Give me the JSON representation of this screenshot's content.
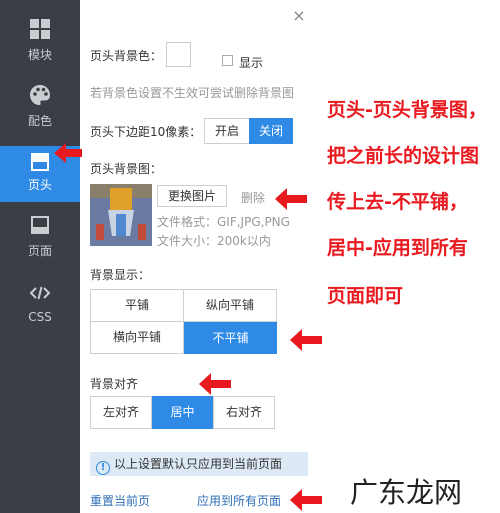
{
  "sidebar": {
    "items": [
      {
        "label": "模块",
        "icon": "grid-icon"
      },
      {
        "label": "配色",
        "icon": "palette-icon"
      },
      {
        "label": "页头",
        "icon": "header-icon",
        "active": true
      },
      {
        "label": "页面",
        "icon": "page-icon"
      },
      {
        "label": "CSS",
        "icon": "code-icon"
      }
    ]
  },
  "panel": {
    "close": "×",
    "bg_color_label": "页头背景色：",
    "show_label": "显示",
    "bg_tip": "若背景色设置不生效可尝试删除背景图",
    "margin_label": "页头下边距10像素：",
    "margin_options": [
      "开启",
      "关闭"
    ],
    "margin_selected": "关闭",
    "bg_image_label": "页头背景图：",
    "replace_button": "更换图片",
    "delete_button": "删除",
    "file_format": "文件格式：GIF,JPG,PNG",
    "file_size": "文件大小：200k以内",
    "display_label": "背景显示：",
    "display_options": [
      "平铺",
      "纵向平铺",
      "横向平铺",
      "不平铺"
    ],
    "display_selected": "不平铺",
    "align_label": "背景对齐",
    "align_options": [
      "左对齐",
      "居中",
      "右对齐"
    ],
    "align_selected": "居中",
    "info_text": "以上设置默认只应用到当前页面",
    "reset_link": "重置当前页",
    "apply_all_link": "应用到所有页面"
  },
  "annotation": {
    "lines": [
      "页头-页头背景图，",
      "把之前长的设计图",
      "传上去-不平铺，",
      "居中-应用到所有",
      "页面即可"
    ],
    "color": "#e8191f"
  },
  "watermark": "广东龙网",
  "colors": {
    "accent": "#2f8ae5",
    "sidebar": "#3b3f45"
  }
}
